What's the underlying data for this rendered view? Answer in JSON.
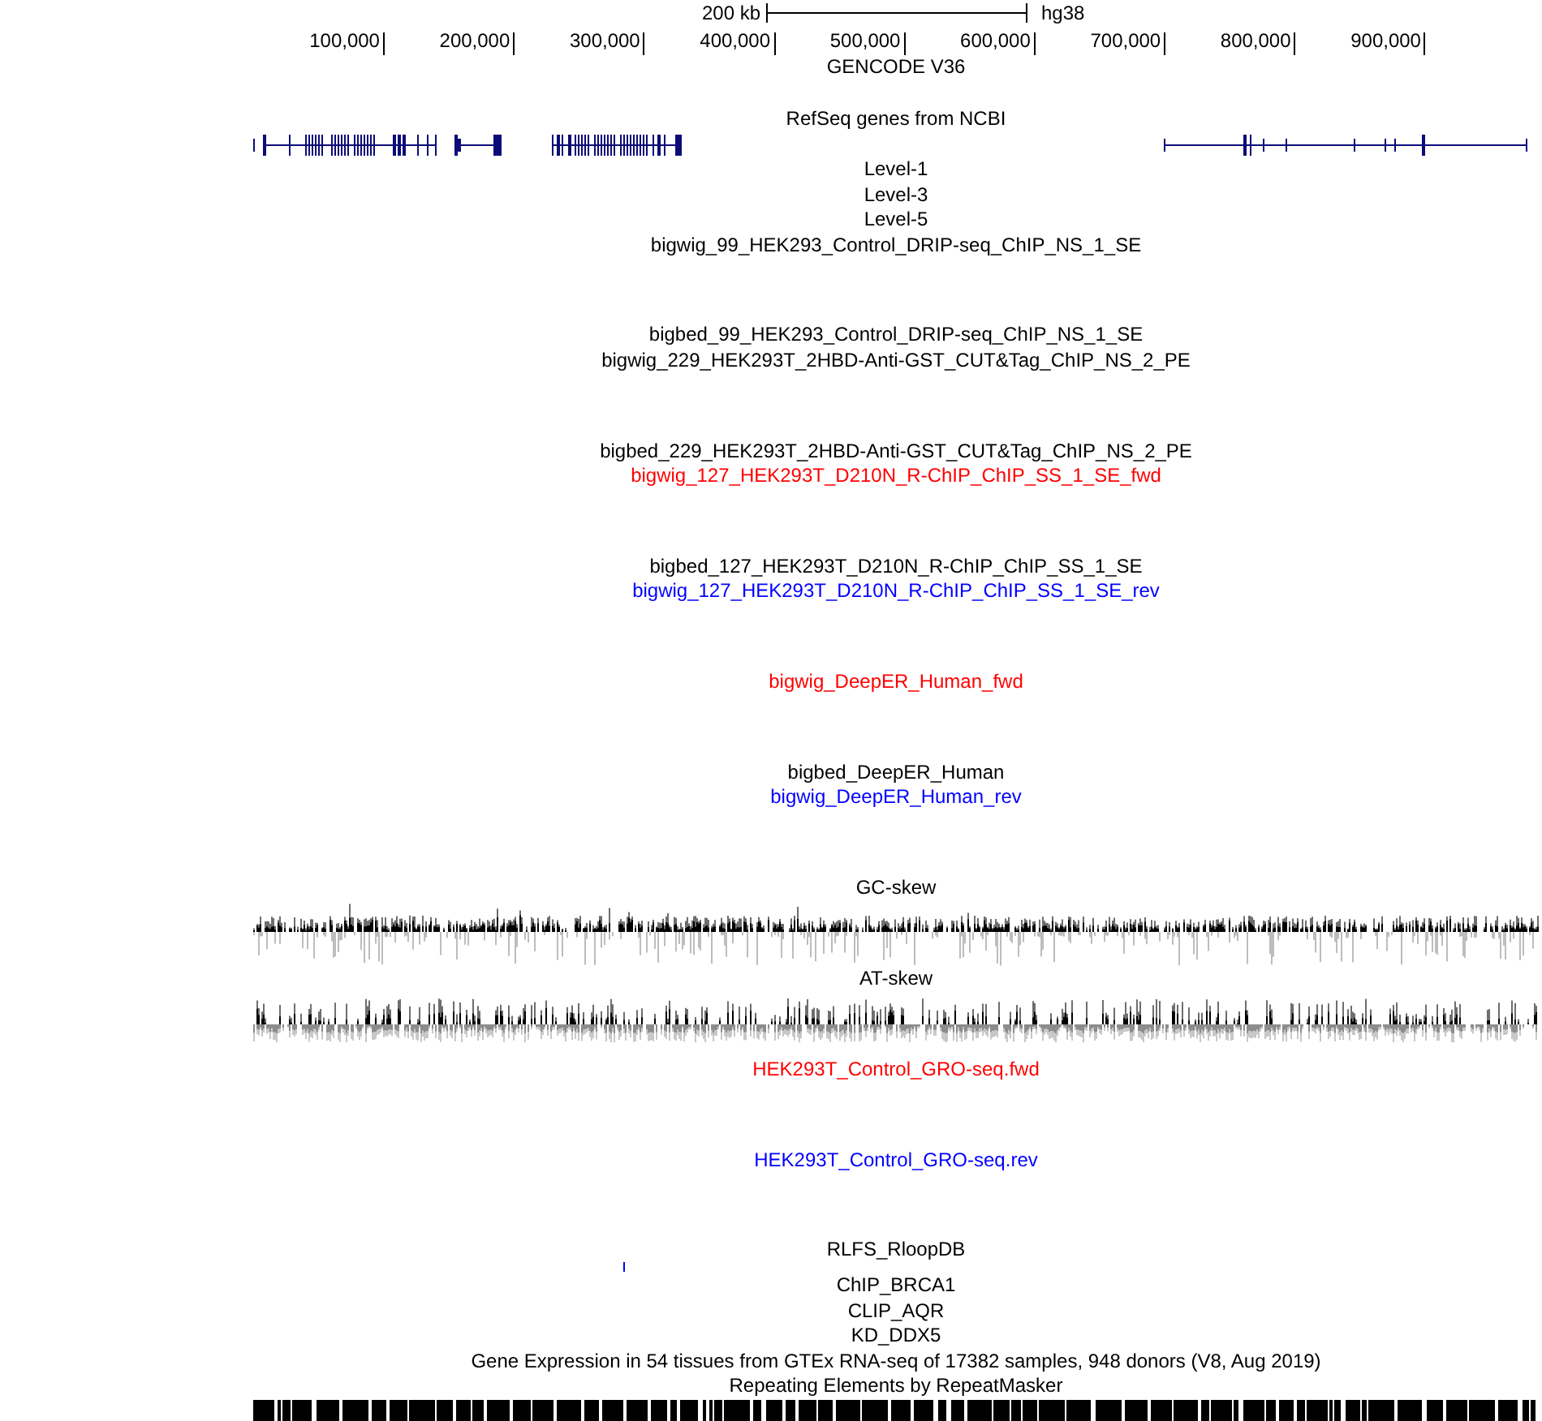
{
  "scale_bar": {
    "label": "200 kb",
    "assembly": "hg38"
  },
  "ruler": [
    "100,000",
    "200,000",
    "300,000",
    "400,000",
    "500,000",
    "600,000",
    "700,000",
    "800,000",
    "900,000"
  ],
  "tracks": [
    {
      "kind": "annotation",
      "title": "GENCODE V36",
      "color": "#000000"
    },
    {
      "kind": "genes",
      "title": "RefSeq genes from NCBI",
      "color": "#000000"
    },
    {
      "kind": "bed",
      "title": "Level-1",
      "color": "#000000"
    },
    {
      "kind": "bed",
      "title": "Level-3",
      "color": "#000000"
    },
    {
      "kind": "bed",
      "title": "Level-5",
      "color": "#000000"
    },
    {
      "kind": "wiggle",
      "title": "bigwig_99_HEK293_Control_DRIP-seq_ChIP_NS_1_SE",
      "color": "#000000"
    },
    {
      "kind": "bed",
      "title": "bigbed_99_HEK293_Control_DRIP-seq_ChIP_NS_1_SE",
      "color": "#000000"
    },
    {
      "kind": "wiggle",
      "title": "bigwig_229_HEK293T_2HBD-Anti-GST_CUT&Tag_ChIP_NS_2_PE",
      "color": "#000000"
    },
    {
      "kind": "bed",
      "title": "bigbed_229_HEK293T_2HBD-Anti-GST_CUT&Tag_ChIP_NS_2_PE",
      "color": "#000000"
    },
    {
      "kind": "wiggle",
      "title": "bigwig_127_HEK293T_D210N_R-ChIP_ChIP_SS_1_SE_fwd",
      "color": "#ff0000"
    },
    {
      "kind": "bed",
      "title": "bigbed_127_HEK293T_D210N_R-ChIP_ChIP_SS_1_SE",
      "color": "#000000"
    },
    {
      "kind": "wiggle",
      "title": "bigwig_127_HEK293T_D210N_R-ChIP_ChIP_SS_1_SE_rev",
      "color": "#0000ff"
    },
    {
      "kind": "wiggle",
      "title": "bigwig_DeepER_Human_fwd",
      "color": "#ff0000"
    },
    {
      "kind": "bed",
      "title": "bigbed_DeepER_Human",
      "color": "#000000"
    },
    {
      "kind": "wiggle",
      "title": "bigwig_DeepER_Human_rev",
      "color": "#0000ff"
    },
    {
      "kind": "skew",
      "title": "GC-skew",
      "color": "#000000"
    },
    {
      "kind": "skew",
      "title": "AT-skew",
      "color": "#000000"
    },
    {
      "kind": "wiggle",
      "title": "HEK293T_Control_GRO-seq.fwd",
      "color": "#ff0000"
    },
    {
      "kind": "wiggle",
      "title": "HEK293T_Control_GRO-seq.rev",
      "color": "#0000ff"
    },
    {
      "kind": "peaks",
      "title": "RLFS_RloopDB",
      "color": "#000000"
    },
    {
      "kind": "bed",
      "title": "ChIP_BRCA1",
      "color": "#000000"
    },
    {
      "kind": "bed",
      "title": "CLIP_AQR",
      "color": "#000000"
    },
    {
      "kind": "bed",
      "title": "KD_DDX5",
      "color": "#000000"
    },
    {
      "kind": "bed",
      "title": "Gene Expression in 54 tissues from GTEx RNA-seq of 17382 samples, 948 donors (V8, Aug 2019)",
      "color": "#000000"
    },
    {
      "kind": "repeats",
      "title": "Repeating Elements by RepeatMasker",
      "color": "#000000"
    }
  ]
}
